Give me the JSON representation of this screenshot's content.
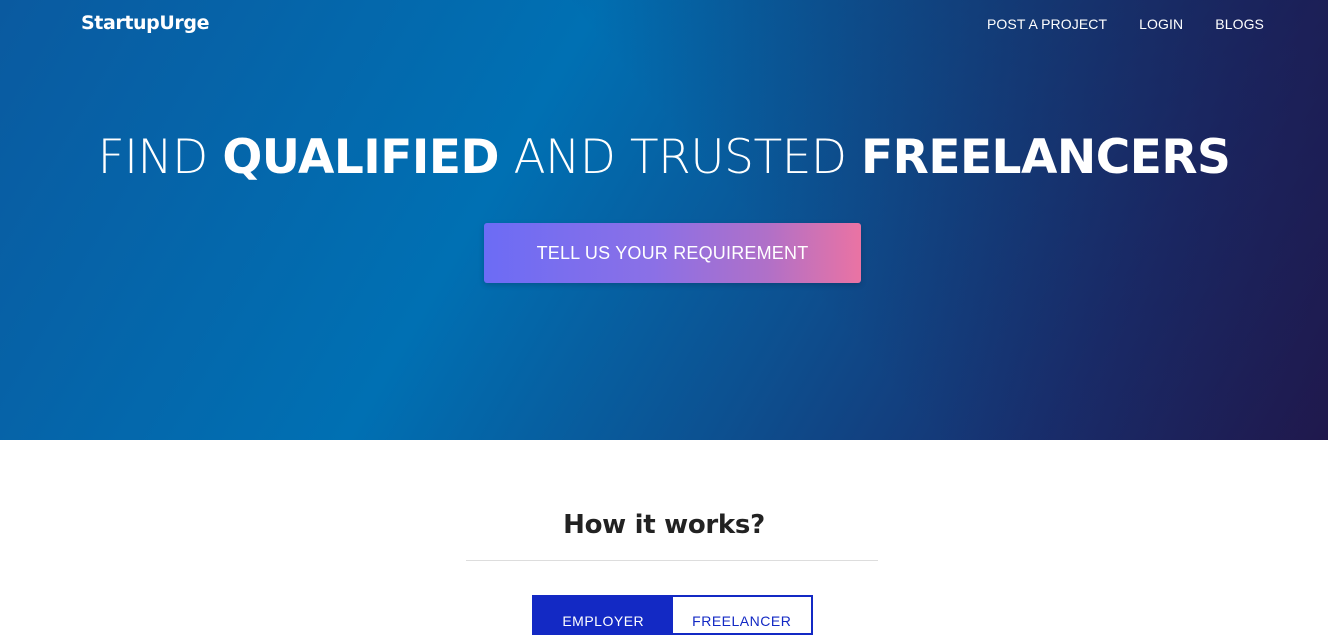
{
  "brand": {
    "name": "StartupUrge"
  },
  "nav": {
    "items": [
      {
        "label": "POST A PROJECT"
      },
      {
        "label": "LOGIN"
      },
      {
        "label": "BLOGS"
      }
    ]
  },
  "hero": {
    "headline": {
      "part1": "FIND ",
      "part2": "QUALIFIED",
      "part3": " AND TRUSTED ",
      "part4": "FREELANCERS"
    },
    "cta_label": "TELL US YOUR REQUIREMENT"
  },
  "how_it_works": {
    "title": "How it works?",
    "tabs": [
      {
        "label": "EMPLOYER",
        "active": true
      },
      {
        "label": "FREELANCER",
        "active": false
      }
    ]
  },
  "colors": {
    "hero_start": "#0070b3",
    "hero_end": "#201a4f",
    "cta_start": "#6c6cf5",
    "cta_end": "#ea73a3",
    "tab_accent": "#1329c4"
  }
}
